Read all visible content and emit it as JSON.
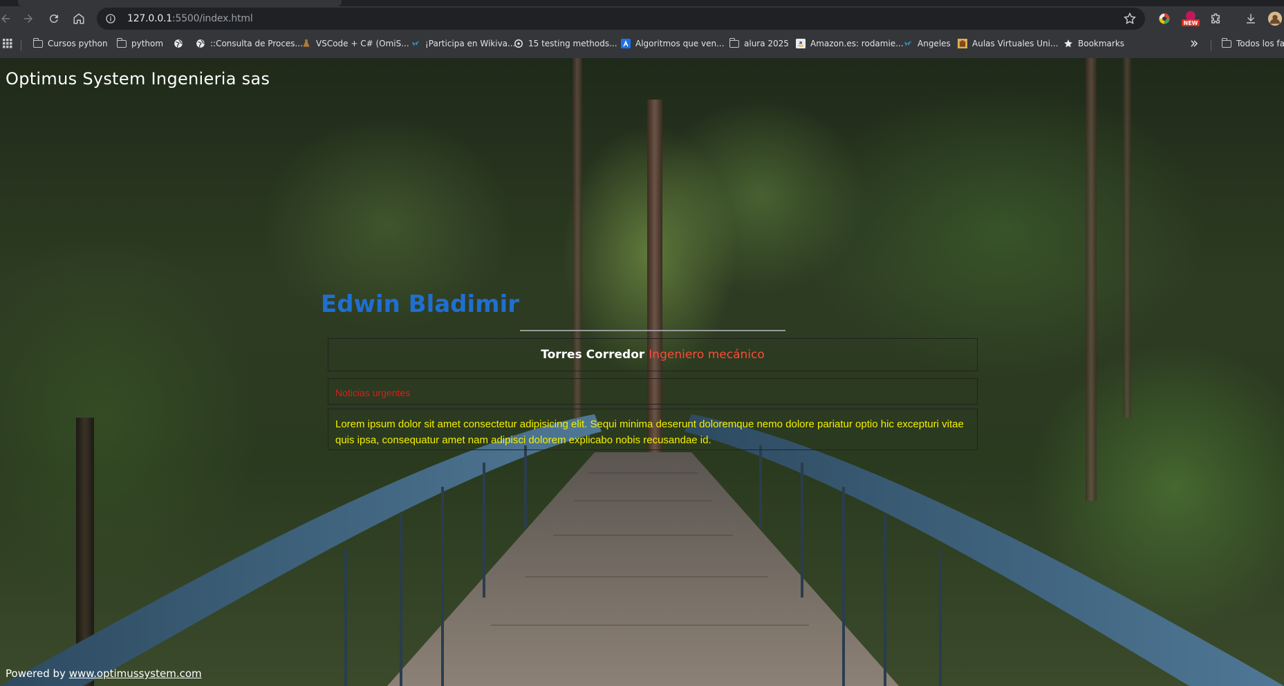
{
  "browser": {
    "url_host": "127.0.0.1",
    "url_rest": ":5500/index.html",
    "extension_badge": "NEW",
    "bookmarks": [
      {
        "label": "Cursos python",
        "icon": "folder-icon"
      },
      {
        "label": "pythom",
        "icon": "folder-icon"
      },
      {
        "label": "",
        "icon": "globe-icon"
      },
      {
        "label": "::Consulta de Proces...",
        "icon": "globe-icon"
      },
      {
        "label": "VSCode + C# (OmiS...",
        "icon": "flask-icon"
      },
      {
        "label": "¡Participa en Wikiva...",
        "icon": "wikivaga-icon"
      },
      {
        "label": "15 testing methods...",
        "icon": "refresh-circle-icon"
      },
      {
        "label": "Algoritmos que ven...",
        "icon": "lambda-icon"
      },
      {
        "label": "alura 2025",
        "icon": "folder-icon"
      },
      {
        "label": "Amazon.es: rodamie...",
        "icon": "amazon-icon"
      },
      {
        "label": "Angeles",
        "icon": "wikivaga-icon"
      },
      {
        "label": "Aulas Virtuales Uni...",
        "icon": "university-icon"
      },
      {
        "label": "Bookmarks",
        "icon": "star-icon"
      },
      {
        "label": "Todos los fav",
        "icon": "folder-icon"
      }
    ]
  },
  "page": {
    "site_title": "Optimus System Ingenieria sas",
    "heading": "Edwin Bladimir",
    "subtitle_name": "Torres Corredor",
    "subtitle_role": "Ingeniero mecánico",
    "news_label": "Noticias urgentes",
    "body_text": "Lorem ipsum dolor sit amet consectetur adipisicing elit. Sequi minima deserunt doloremque nemo dolore pariatur optio hic excepturi vitae quis ipsa, consequatur amet nam adipisci dolorem explicabo nobis recusandae id.",
    "footer_prefix": "Powered by",
    "footer_link": "www.optimussystem.com"
  },
  "colors": {
    "heading": "#1f6fd1",
    "role": "#ff4a35",
    "news": "#d81e1e",
    "body_text": "#f5f000"
  }
}
